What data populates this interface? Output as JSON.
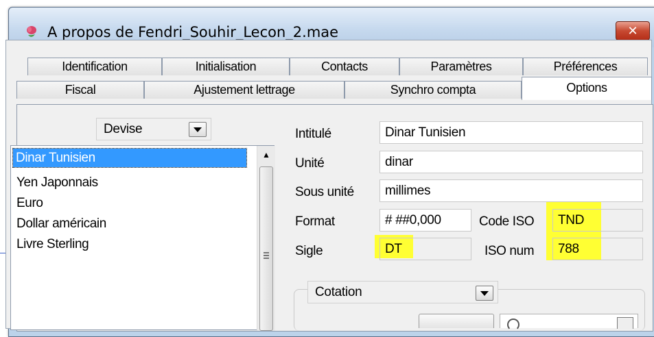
{
  "window": {
    "title": "A propos de Fendri_Souhir_Lecon_2.mae"
  },
  "tabs_row1": [
    "Identification",
    "Initialisation",
    "Contacts",
    "Paramètres",
    "Préférences"
  ],
  "tabs_row2": [
    "Fiscal",
    "Ajustement lettrage",
    "Synchro compta",
    "Options"
  ],
  "active_tab": "Options",
  "devise_combo": {
    "value": "Devise"
  },
  "currency_list": {
    "items": [
      "Dinar Tunisien",
      "Yen Japonnais",
      "Euro",
      "Dollar américain",
      "Livre Sterling"
    ],
    "selected": "Dinar Tunisien"
  },
  "form": {
    "intitule_label": "Intitulé",
    "intitule_value": "Dinar Tunisien",
    "unite_label": "Unité",
    "unite_value": "dinar",
    "sous_unite_label": "Sous unité",
    "sous_unite_value": "millimes",
    "format_label": "Format",
    "format_value": "# ##0,000",
    "code_iso_label": "Code ISO",
    "code_iso_value": "TND",
    "sigle_label": "Sigle",
    "sigle_value": "DT",
    "iso_num_label": "ISO num",
    "iso_num_value": "788"
  },
  "cotation_combo": {
    "value": "Cotation"
  },
  "colors": {
    "highlight": "#ffff33",
    "selection": "#3399ff",
    "close_button": "#c74a32"
  },
  "icons": {
    "app": "flower-icon",
    "close": "close-icon",
    "dropdown": "chevron-down-icon",
    "scroll_up": "scroll-up-arrow-icon"
  }
}
